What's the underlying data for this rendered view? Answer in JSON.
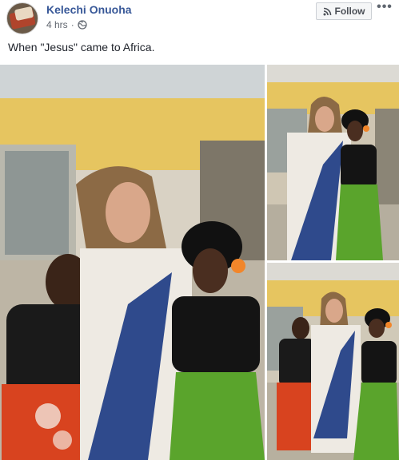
{
  "post": {
    "author": "Kelechi Onuoha",
    "timestamp": "4 hrs",
    "audience_icon": "globe-icon",
    "follow_label": "Follow",
    "follow_icon": "rss-icon",
    "more_label": "•••",
    "text": "When \"Jesus\" came to Africa."
  },
  "photos": [
    {
      "name": "main-photo"
    },
    {
      "name": "top-right-photo"
    },
    {
      "name": "bottom-right-photo"
    }
  ],
  "colors": {
    "author_link": "#385898",
    "meta_text": "#616770",
    "button_bg": "#f5f6f7",
    "robe_blue": "#2f4a8c",
    "skirt_green": "#5aa42c",
    "skirt_red": "#d8431f",
    "wall_yellow": "#e6c560"
  }
}
